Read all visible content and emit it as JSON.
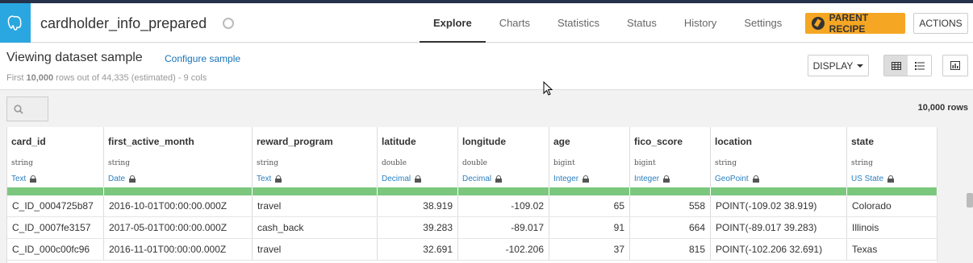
{
  "header": {
    "dataset_name": "cardholder_info_prepared",
    "tabs": [
      "Explore",
      "Charts",
      "Statistics",
      "Status",
      "History",
      "Settings"
    ],
    "active_tab": "Explore",
    "parent_recipe_label": "PARENT RECIPE",
    "actions_label": "ACTIONS",
    "accent_color": "#f5a623",
    "logo_color": "#2aa7e0"
  },
  "subheader": {
    "title": "Viewing dataset sample",
    "configure_label": "Configure sample",
    "rows_prefix": "First ",
    "rows_bold": "10,000",
    "rows_suffix": " rows out of 44,335 (estimated) - 9 cols",
    "display_label": "DISPLAY"
  },
  "filterbar": {
    "row_count": "10,000 rows"
  },
  "table": {
    "columns": [
      {
        "name": "card_id",
        "type": "string",
        "meaning": "Text"
      },
      {
        "name": "first_active_month",
        "type": "string",
        "meaning": "Date"
      },
      {
        "name": "reward_program",
        "type": "string",
        "meaning": "Text"
      },
      {
        "name": "latitude",
        "type": "double",
        "meaning": "Decimal"
      },
      {
        "name": "longitude",
        "type": "double",
        "meaning": "Decimal"
      },
      {
        "name": "age",
        "type": "bigint",
        "meaning": "Integer"
      },
      {
        "name": "fico_score",
        "type": "bigint",
        "meaning": "Integer"
      },
      {
        "name": "location",
        "type": "string",
        "meaning": "GeoPoint"
      },
      {
        "name": "state",
        "type": "string",
        "meaning": "US State"
      }
    ],
    "rows": [
      [
        "C_ID_0004725b87",
        "2016-10-01T00:00:00.000Z",
        "travel",
        "38.919",
        "-109.02",
        "65",
        "558",
        "POINT(-109.02 38.919)",
        "Colorado"
      ],
      [
        "C_ID_0007fe3157",
        "2017-05-01T00:00:00.000Z",
        "cash_back",
        "39.283",
        "-89.017",
        "91",
        "664",
        "POINT(-89.017 39.283)",
        "Illinois"
      ],
      [
        "C_ID_000c00fc96",
        "2016-11-01T00:00:00.000Z",
        "travel",
        "32.691",
        "-102.206",
        "37",
        "815",
        "POINT(-102.206 32.691)",
        "Texas"
      ]
    ],
    "quality_color": "#7bc77e"
  }
}
